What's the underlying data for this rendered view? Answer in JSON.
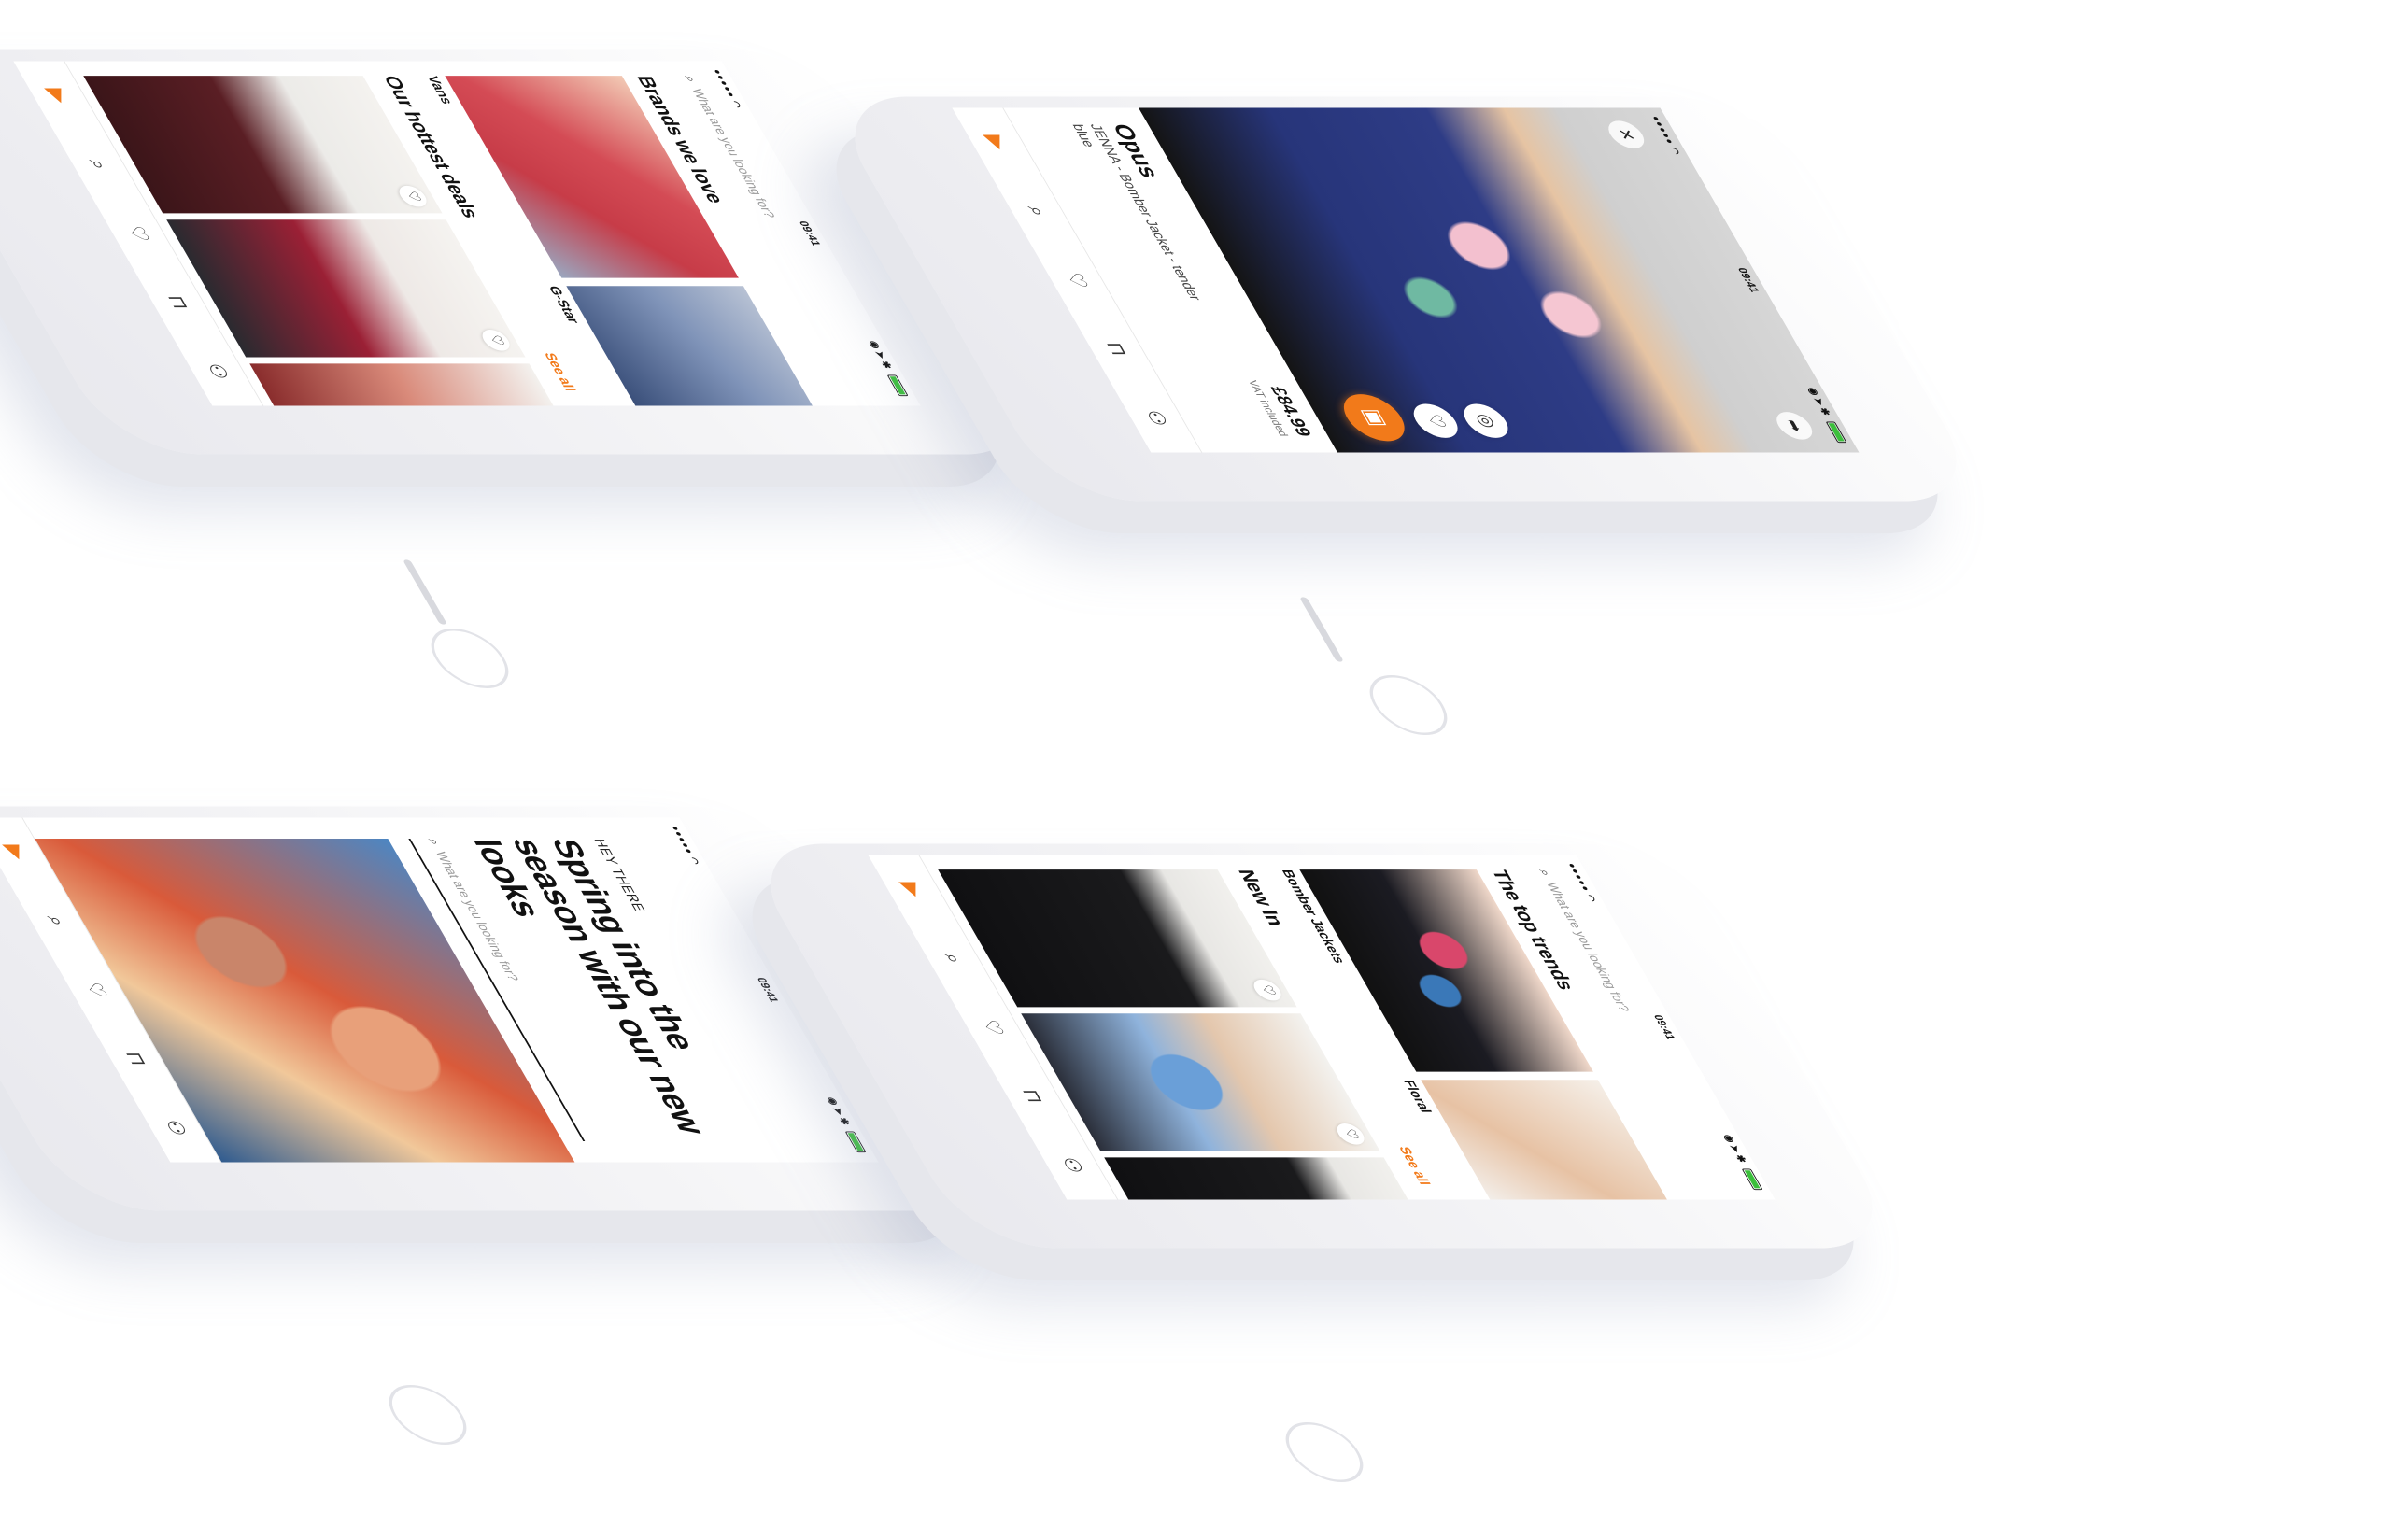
{
  "colors": {
    "accent": "#f27a1a",
    "battery": "#3bbf3b"
  },
  "status_bar": {
    "time": "09:41",
    "signal": "●●●●● ◠",
    "icons": "◉ ➤ ✱"
  },
  "search": {
    "placeholder": "What are you looking for?",
    "icon": "search-icon"
  },
  "tabbar": {
    "items": [
      {
        "name": "home",
        "icon": "zalando-logo-icon",
        "glyph": "▶"
      },
      {
        "name": "search",
        "icon": "search-list-icon",
        "glyph": "⌕"
      },
      {
        "name": "wishlist",
        "icon": "heart-icon",
        "glyph": "♡"
      },
      {
        "name": "bag",
        "icon": "bag-icon",
        "glyph": "⊓"
      },
      {
        "name": "account",
        "icon": "user-icon",
        "glyph": "⚇"
      }
    ]
  },
  "phone_home": {
    "brands_title": "Brands we love",
    "brands": [
      {
        "label": "Vans"
      },
      {
        "label": "G-Star"
      }
    ],
    "deals_title": "Our hottest deals",
    "see_all": "See all"
  },
  "phone_pdp": {
    "brand": "Opus",
    "name": "JENNA - Bomber Jacket - tender blue",
    "price": "£84.99",
    "vat": "VAT included"
  },
  "phone_hero": {
    "kicker": "HEY THERE",
    "title": "Spring into the season with our new looks"
  },
  "phone_trends": {
    "trends_title": "The top trends",
    "trends": [
      {
        "label": "Bomber Jackets"
      },
      {
        "label": "Floral"
      }
    ],
    "new_in_title": "New In",
    "see_all": "See all"
  }
}
